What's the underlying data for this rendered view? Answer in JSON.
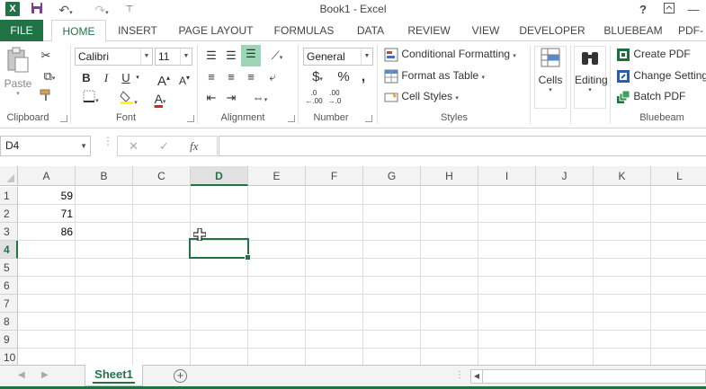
{
  "app": {
    "window_title": "Book1 - Excel",
    "help": "?",
    "logo": "X"
  },
  "tabs": [
    "FILE",
    "HOME",
    "INSERT",
    "PAGE LAYOUT",
    "FORMULAS",
    "DATA",
    "REVIEW",
    "VIEW",
    "DEVELOPER",
    "BLUEBEAM",
    "PDF-"
  ],
  "active_tab": "HOME",
  "ribbon": {
    "clipboard": {
      "paste": "Paste",
      "label": "Clipboard"
    },
    "font": {
      "family": "Calibri",
      "size": "11",
      "bold": "B",
      "italic": "I",
      "underline": "U",
      "label": "Font"
    },
    "alignment": {
      "label": "Alignment"
    },
    "number": {
      "format": "General",
      "currency": "$",
      "percent": "%",
      "comma": ",",
      "label": "Number"
    },
    "styles": {
      "conditional_formatting": "Conditional Formatting",
      "format_as_table": "Format as Table",
      "cell_styles": "Cell Styles",
      "label": "Styles"
    },
    "cells": {
      "label": "Cells"
    },
    "editing": {
      "label": "Editing"
    },
    "bluebeam": {
      "create_pdf": "Create PDF",
      "change_settings": "Change Settings",
      "batch_pdf": "Batch PDF",
      "label": "Bluebeam"
    }
  },
  "formula_bar": {
    "name_box": "D4",
    "cancel_icon": "✕",
    "enter_icon": "✓",
    "fx": "fx",
    "formula": ""
  },
  "grid": {
    "columns": [
      "A",
      "B",
      "C",
      "D",
      "E",
      "F",
      "G",
      "H",
      "I",
      "J",
      "K",
      "L"
    ],
    "rows": [
      "1",
      "2",
      "3",
      "4",
      "5",
      "6",
      "7",
      "8",
      "9",
      "10"
    ],
    "selected_column": "D",
    "selected_row": "4",
    "cells": [
      {
        "ref": "A1",
        "value": "59"
      },
      {
        "ref": "A2",
        "value": "71"
      },
      {
        "ref": "A3",
        "value": "86"
      }
    ]
  },
  "sheets": {
    "tabs": [
      "Sheet1"
    ],
    "active": "Sheet1",
    "add": "+"
  },
  "colors": {
    "accent": "#217346",
    "gridline": "#dadcdd",
    "header_bg": "#f3f3f3"
  }
}
